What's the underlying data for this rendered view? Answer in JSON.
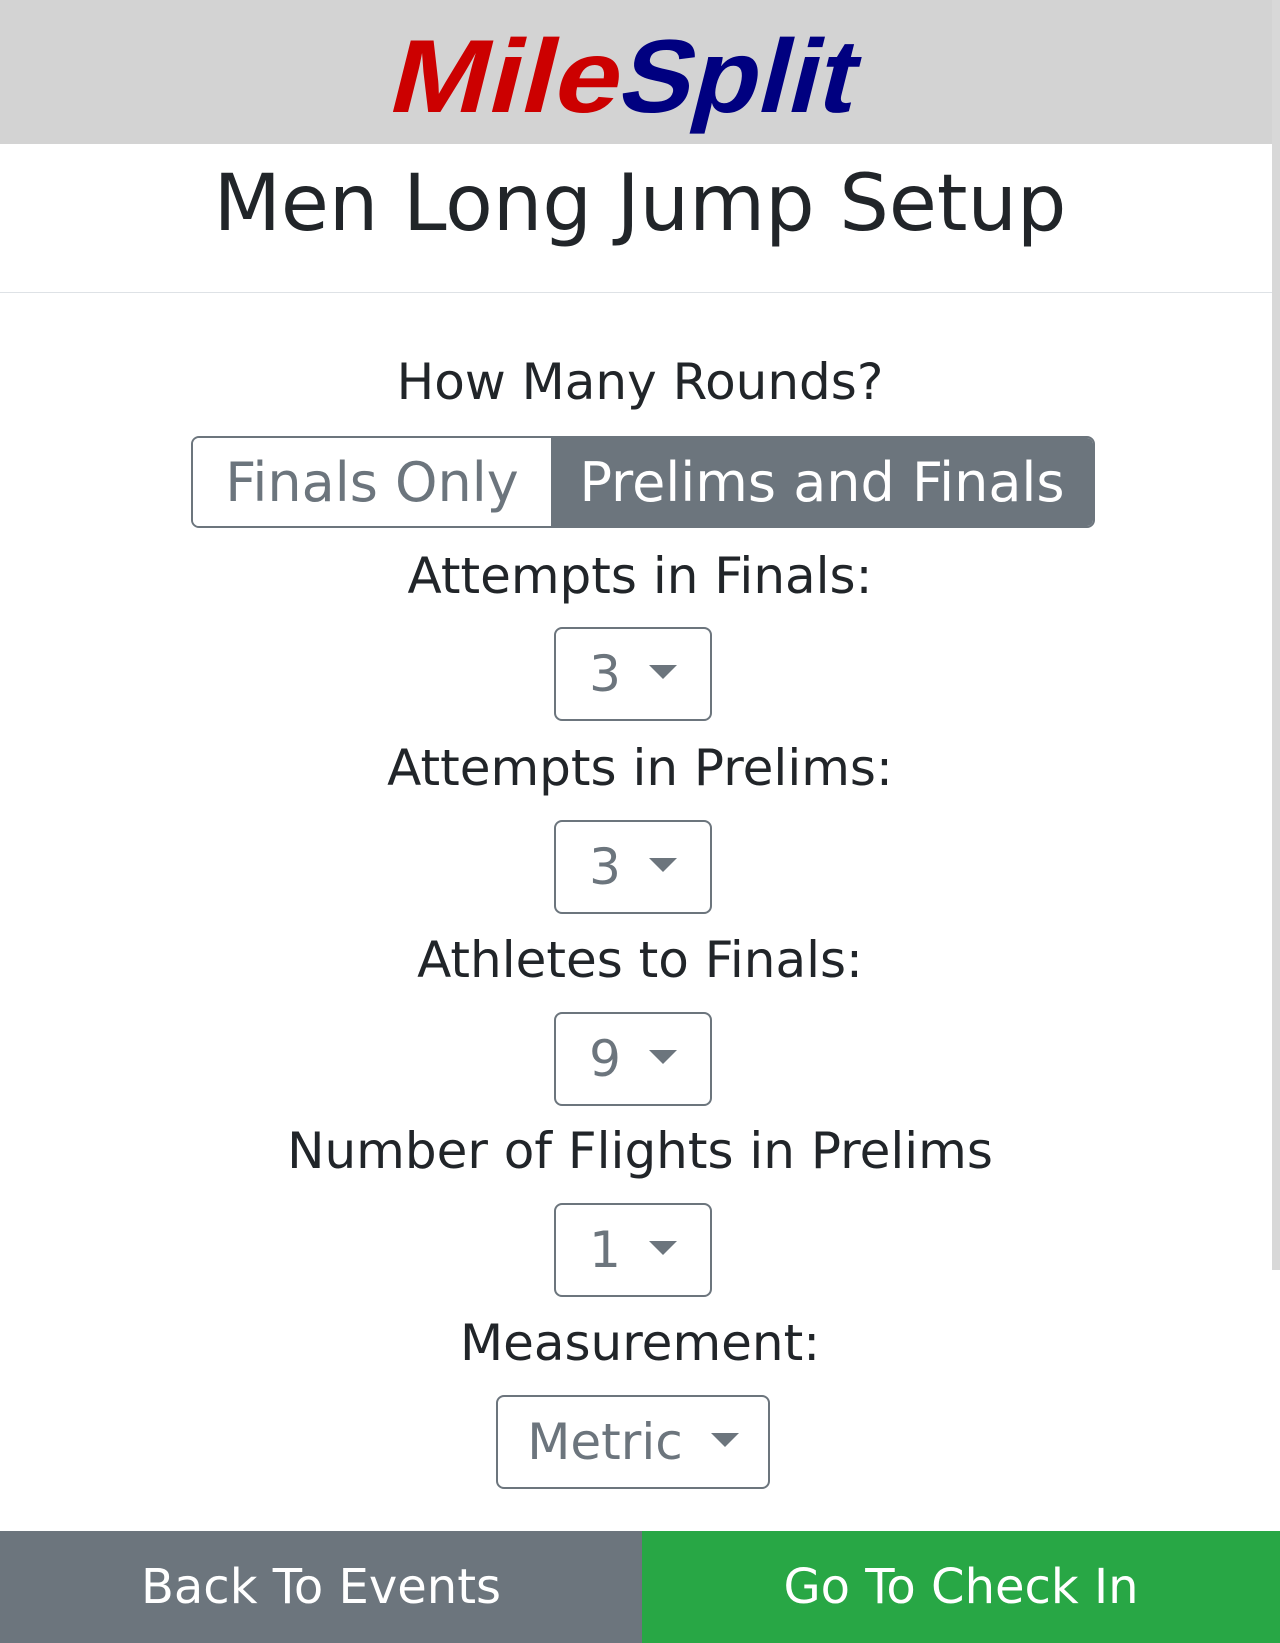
{
  "header": {
    "logo_text": "MileSplit",
    "logo_colors": {
      "mile": "#cc0000",
      "split": "#000080"
    }
  },
  "page": {
    "title": "Men Long Jump Setup"
  },
  "rounds": {
    "label": "How Many Rounds?",
    "options": [
      "Finals Only",
      "Prelims and Finals"
    ],
    "selected": "Prelims and Finals"
  },
  "attempts_finals": {
    "label": "Attempts in Finals:",
    "value": "3"
  },
  "attempts_prelims": {
    "label": "Attempts in Prelims:",
    "value": "3"
  },
  "athletes_to_finals": {
    "label": "Athletes to Finals:",
    "value": "9"
  },
  "flights_prelims": {
    "label": "Number of Flights in Prelims",
    "value": "1"
  },
  "measurement": {
    "label": "Measurement:",
    "value": "Metric"
  },
  "footer": {
    "back_label": "Back To Events",
    "checkin_label": "Go To Check In"
  },
  "colors": {
    "header_bg": "#d3d3d3",
    "secondary": "#6c757d",
    "success": "#28a745"
  }
}
